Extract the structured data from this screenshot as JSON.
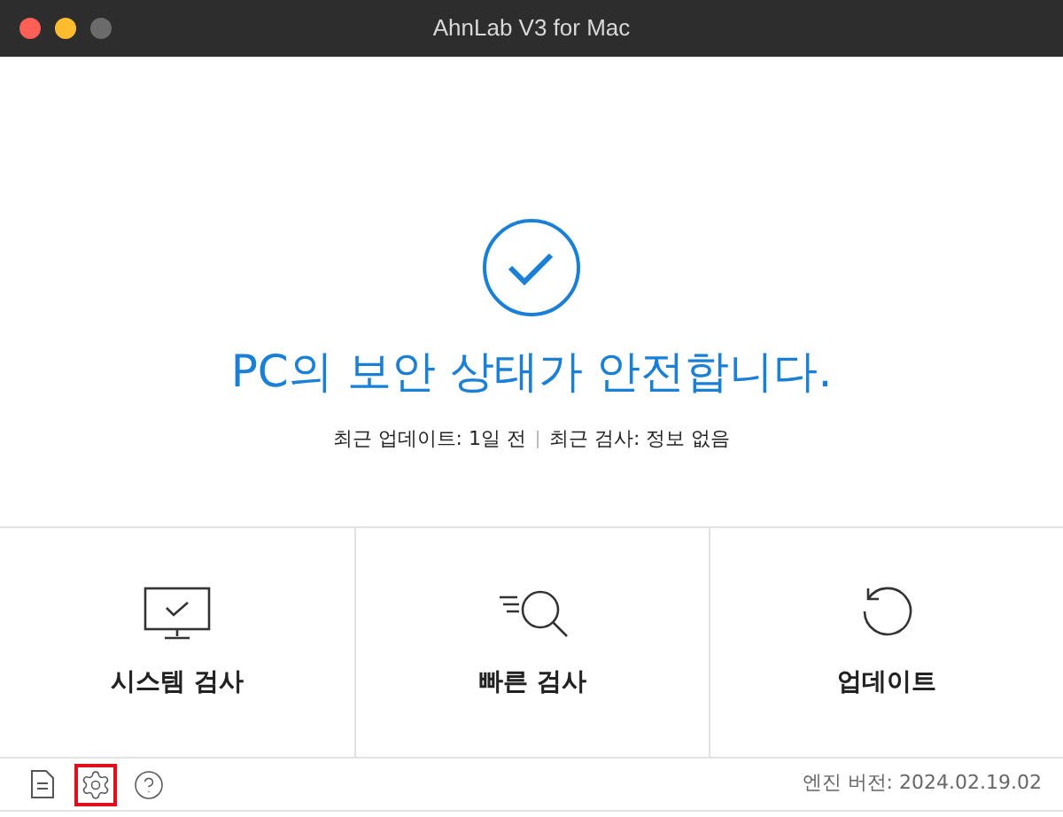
{
  "window": {
    "title": "AhnLab V3 for Mac"
  },
  "status": {
    "headline": "PC의 보안 상태가 안전합니다.",
    "last_update": "최근 업데이트: 1일 전",
    "last_scan": "최근 검사: 정보 없음"
  },
  "actions": [
    {
      "kind": "system",
      "label": "시스템 검사"
    },
    {
      "kind": "quick",
      "label": "빠른 검사"
    },
    {
      "kind": "update",
      "label": "업데이트"
    }
  ],
  "footer": {
    "tools": [
      {
        "kind": "log",
        "highlighted": false
      },
      {
        "kind": "settings",
        "highlighted": true
      },
      {
        "kind": "help",
        "highlighted": false
      }
    ],
    "engine_version": "엔진 버전: 2024.02.19.02"
  }
}
